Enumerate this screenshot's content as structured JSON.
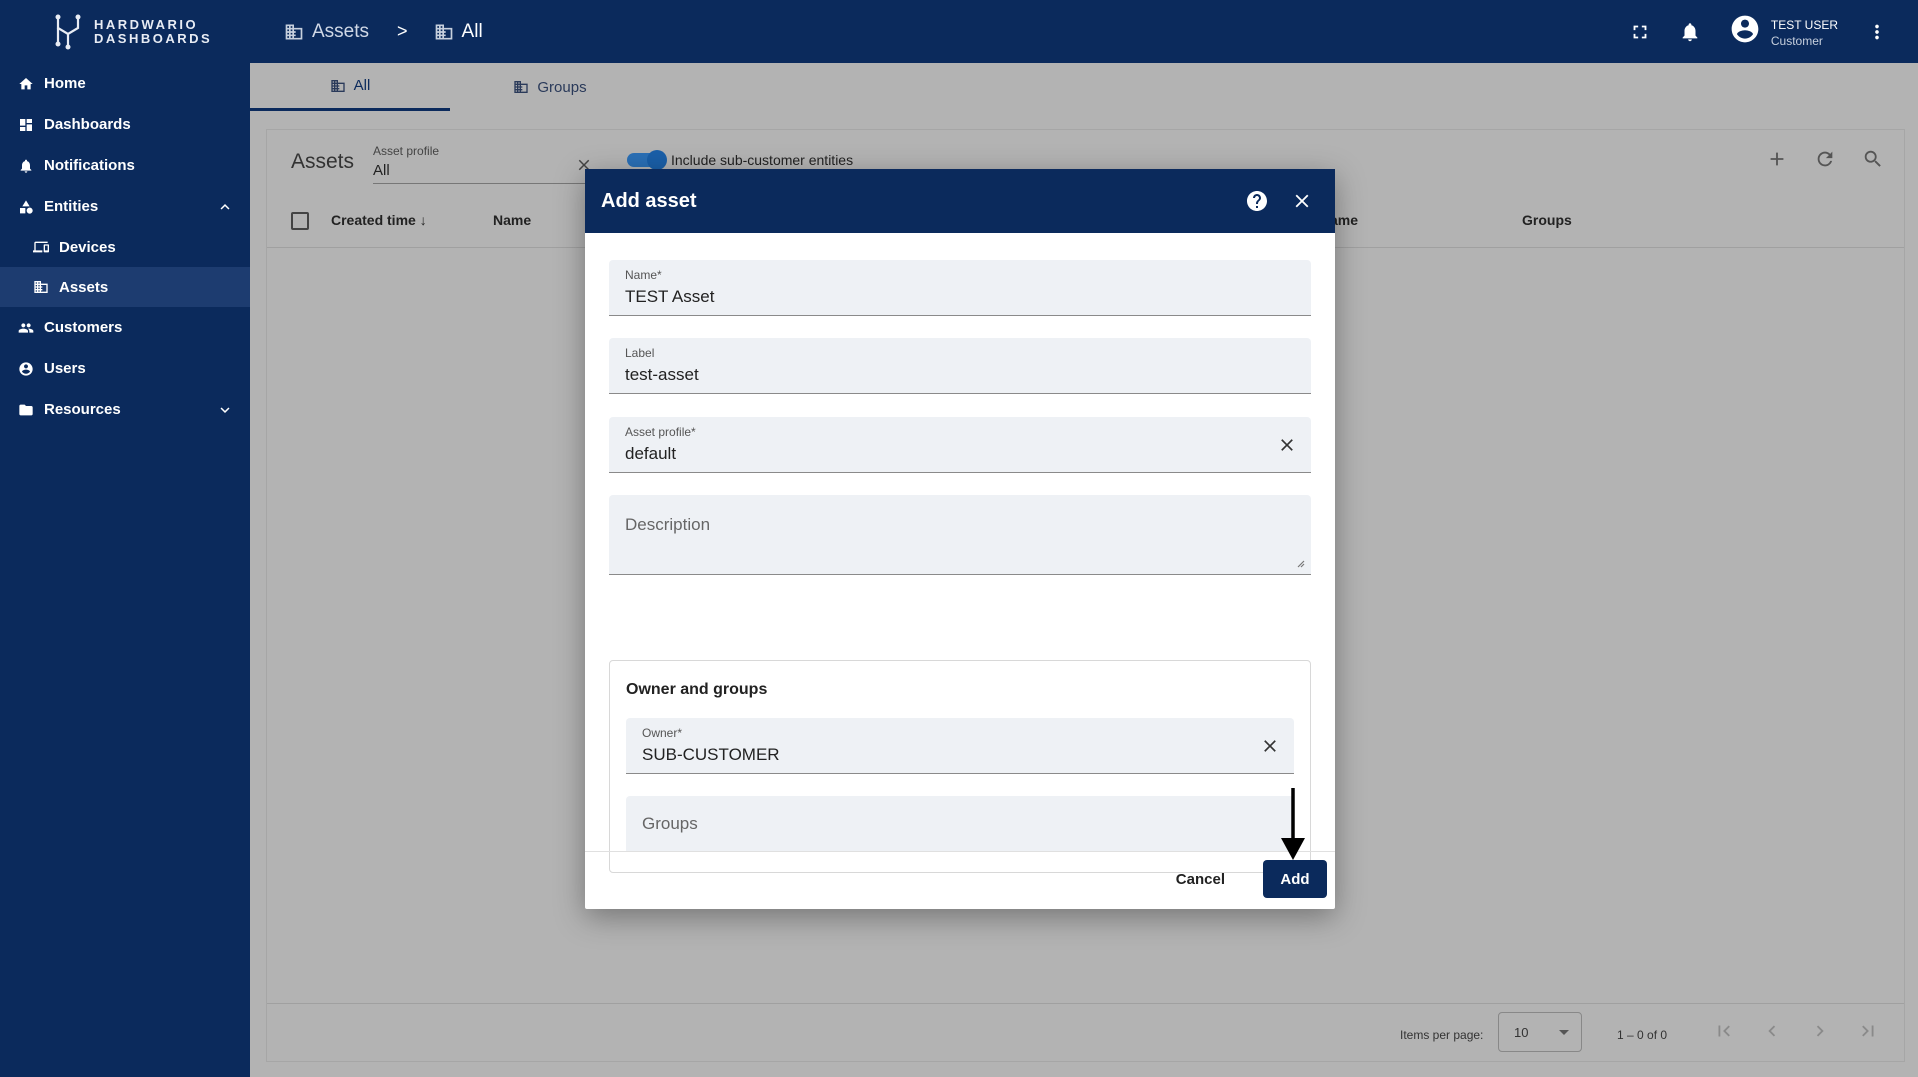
{
  "brand": {
    "line1": "HARDWARIO",
    "line2": "DASHBOARDS"
  },
  "sidebar": {
    "items": [
      {
        "label": "Home",
        "icon": "home-icon"
      },
      {
        "label": "Dashboards",
        "icon": "dashboard-icon"
      },
      {
        "label": "Notifications",
        "icon": "notifications-icon"
      },
      {
        "label": "Entities",
        "icon": "entities-icon",
        "expanded": true
      },
      {
        "label": "Devices",
        "icon": "devices-icon"
      },
      {
        "label": "Assets",
        "icon": "assets-icon",
        "active": true
      },
      {
        "label": "Customers",
        "icon": "customers-icon"
      },
      {
        "label": "Users",
        "icon": "users-icon"
      },
      {
        "label": "Resources",
        "icon": "folder-icon",
        "expanded": false
      }
    ]
  },
  "topbar": {
    "breadcrumb": [
      "Assets",
      "All"
    ],
    "separator": ">",
    "user_name": "TEST USER",
    "user_role": "Customer"
  },
  "tabs": [
    {
      "label": "All",
      "active": true
    },
    {
      "label": "Groups"
    }
  ],
  "panel": {
    "title": "Assets",
    "asset_profile_label": "Asset profile",
    "asset_profile_value": "All",
    "toggle_label": "Include sub-customer entities",
    "columns": [
      "Created time",
      "Name",
      "ame",
      "Groups"
    ]
  },
  "paginator": {
    "items_per_page_label": "Items per page:",
    "items_per_page": "10",
    "range": "1 – 0 of 0"
  },
  "dialog": {
    "title": "Add asset",
    "name_label": "Name*",
    "name_value": "TEST Asset",
    "label_label": "Label",
    "label_value": "test-asset",
    "profile_label": "Asset profile*",
    "profile_value": "default",
    "description_placeholder": "Description",
    "owner_section_title": "Owner and groups",
    "owner_label": "Owner*",
    "owner_value": "SUB-CUSTOMER",
    "groups_placeholder": "Groups",
    "cancel_label": "Cancel",
    "add_label": "Add"
  },
  "colors": {
    "primary": "#0b2a5c",
    "backdrop": "#b3b3b3"
  }
}
